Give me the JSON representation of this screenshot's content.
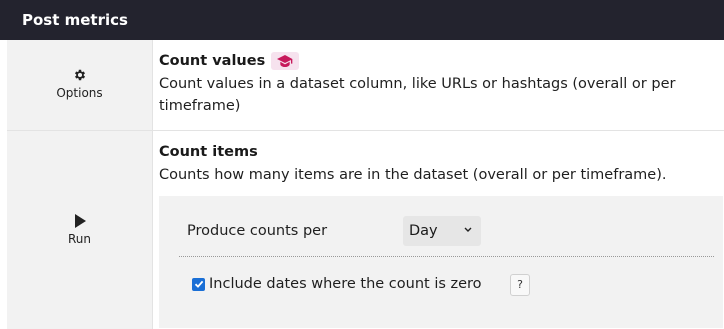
{
  "header": {
    "title": "Post metrics"
  },
  "row1": {
    "action_label": "Options",
    "action_icon": "gear-icon",
    "title": "Count values",
    "badge_icon": "graduation-cap-icon",
    "description": "Count values in a dataset column, like URLs or hashtags (overall or per timeframe)"
  },
  "row2": {
    "action_label": "Run",
    "action_icon": "play-icon",
    "title": "Count items",
    "description": "Counts how many items are in the dataset (overall or per timeframe).",
    "options": {
      "frequency_label": "Produce counts per",
      "frequency_value": "Day",
      "include_empty_label": "Include dates where the count is zero",
      "include_empty_checked": true,
      "help_label": "?"
    }
  },
  "colors": {
    "header_bg": "#23232e",
    "badge_bg": "#f6e2ee",
    "badge_fg": "#c7195b",
    "checkbox": "#1a6fd6"
  }
}
